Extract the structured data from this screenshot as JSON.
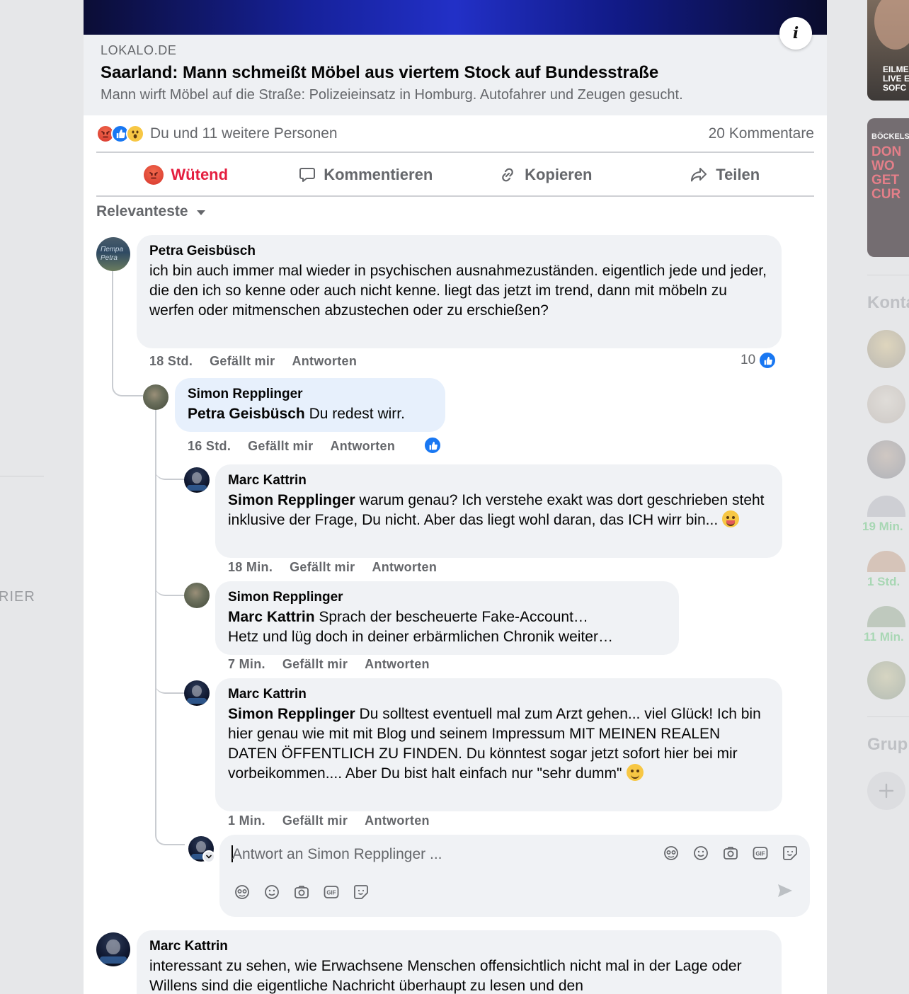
{
  "background": {
    "left_clip_text": "RIER"
  },
  "right_column": {
    "ad1_text": [
      "EILME",
      "LIVE E",
      "SOFC"
    ],
    "ad2_text": [
      "BÖCKELS",
      "DON",
      "WO",
      "GET",
      "CUR"
    ],
    "contacts_heading": "Konta",
    "contact_times": [
      "19 Min.",
      "1 Std.",
      "11 Min."
    ],
    "groups_heading": "Grup"
  },
  "link_preview": {
    "domain": "LOKALO.DE",
    "title": "Saarland: Mann schmeißt Möbel aus viertem Stock auf Bundesstraße",
    "description": "Mann wirft Möbel auf die Straße: Polizeieinsatz in Homburg. Autofahrer und Zeugen gesucht."
  },
  "reactions": {
    "summary": "Du und 11 weitere Personen",
    "comments_count": "20 Kommentare"
  },
  "actions": {
    "react": "Wütend",
    "comment": "Kommentieren",
    "copy": "Kopieren",
    "share": "Teilen"
  },
  "sort": {
    "label": "Relevanteste"
  },
  "comments": [
    {
      "author": "Petra Geisbüsch",
      "text": "ich bin auch immer mal wieder in psychischen ausnahmezuständen. eigentlich jede und jeder, die den ich so kenne oder auch nicht kenne. liegt das jetzt im trend, dann mit möbeln zu werfen oder mitmenschen abzustechen oder zu erschießen?",
      "time": "18 Std.",
      "like": "Gefällt mir",
      "reply": "Antworten",
      "likes": "10",
      "avatar_text": [
        "Петра",
        "Petra"
      ]
    },
    {
      "author": "Simon Repplinger",
      "mention": "Petra Geisbüsch",
      "text": " Du redest wirr.",
      "time": "16 Std.",
      "like": "Gefällt mir",
      "reply": "Antworten"
    },
    {
      "author": "Marc Kattrin",
      "mention": "Simon Repplinger",
      "text": " warum genau? Ich verstehe exakt was dort geschrieben steht inklusive der Frage, Du nicht. Aber das liegt wohl daran, das ICH wirr bin...",
      "time": "18 Min.",
      "like": "Gefällt mir",
      "reply": "Antworten"
    },
    {
      "author": "Simon Repplinger",
      "mention": "Marc Kattrin",
      "text": " Sprach der bescheuerte Fake-Account…",
      "text2": "Hetz und lüg doch in deiner erbärmlichen Chronik weiter…",
      "time": "7 Min.",
      "like": "Gefällt mir",
      "reply": "Antworten"
    },
    {
      "author": "Marc Kattrin",
      "mention": "Simon Repplinger",
      "text": " Du solltest eventuell mal zum Arzt gehen... viel Glück! Ich bin hier genau wie mit mit Blog und seinem Impressum MIT MEINEN REALEN DATEN ÖFFENTLICH ZU FINDEN. Du könntest sogar jetzt sofort hier bei mir vorbeikommen.... Aber Du bist halt einfach nur \"sehr dumm\"",
      "time": "1 Min.",
      "like": "Gefällt mir",
      "reply": "Antworten"
    },
    {
      "author": "Marc Kattrin",
      "text": "interessant zu sehen, wie Erwachsene Menschen offensichtlich nicht mal in der Lage oder Willens sind die eigentliche Nachricht überhaupt zu lesen und den"
    }
  ],
  "reply_box": {
    "placeholder": "Antwort an Simon Repplinger ..."
  },
  "colors": {
    "accent_blue": "#1877f2",
    "angry_red": "#e41e3f",
    "bubble_gray": "#f0f2f5",
    "bubble_highlight": "#e7f0fc"
  }
}
